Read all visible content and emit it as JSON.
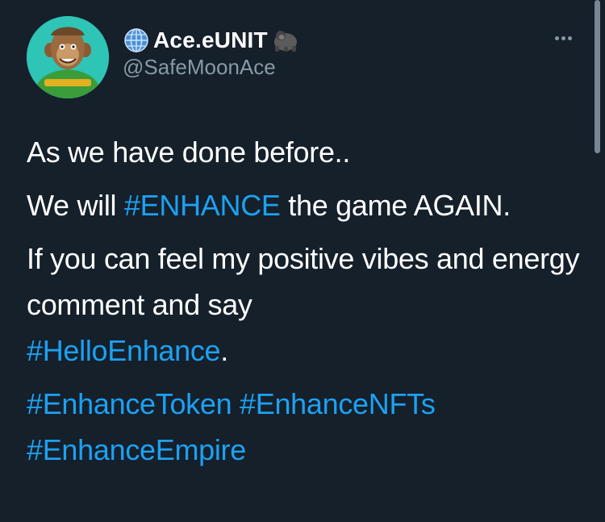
{
  "author": {
    "display_name": "Ace.eUNIT",
    "handle": "@SafeMoonAce",
    "prefix_icon": "globe-icon",
    "suffix_icon": "gorilla-icon",
    "avatar": "cartoon-ape-avatar"
  },
  "colors": {
    "background": "#15202b",
    "text": "#ffffff",
    "secondary": "#8899a6",
    "hashtag": "#1da1f2"
  },
  "tweet": {
    "line1": "As we have done before..",
    "line2_pre": "We will ",
    "line2_tag": "#ENHANCE",
    "line2_post": " the game AGAIN.",
    "para3_text": "If you can feel my positive vibes and energy comment and say",
    "para3_tag": "#HelloEnhance",
    "para3_post": ".",
    "tags": [
      "#EnhanceToken",
      "#EnhanceNFTs",
      "#EnhanceEmpire"
    ]
  }
}
